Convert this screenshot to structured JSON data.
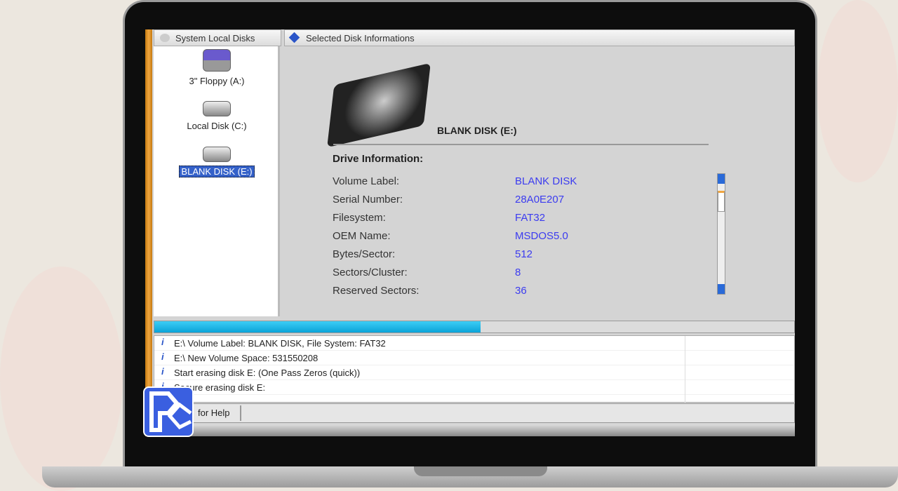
{
  "left_panel": {
    "title": "System Local Disks",
    "drives": [
      {
        "label": "3\" Floppy (A:)",
        "icon": "floppy-drive-icon"
      },
      {
        "label": "Local Disk (C:)",
        "icon": "hard-drive-icon"
      },
      {
        "label": "BLANK DISK (E:)",
        "icon": "hard-drive-icon",
        "selected": true
      }
    ]
  },
  "right_panel": {
    "title": "Selected Disk Informations",
    "disk_name": "BLANK DISK  (E:)",
    "section": "Drive Information:",
    "fields": [
      {
        "label": "Volume Label:",
        "value": "BLANK DISK"
      },
      {
        "label": "Serial Number:",
        "value": "28A0E207"
      },
      {
        "label": "Filesystem:",
        "value": "FAT32"
      },
      {
        "label": "OEM Name:",
        "value": "MSDOS5.0"
      },
      {
        "label": "Bytes/Sector:",
        "value": "512"
      },
      {
        "label": "Sectors/Cluster:",
        "value": "8"
      },
      {
        "label": "Reserved Sectors:",
        "value": "36"
      }
    ]
  },
  "progress_percent": 51,
  "log": [
    "E:\\ Volume Label: BLANK DISK, File System: FAT32",
    "E:\\ New Volume Space: 531550208",
    "Start erasing disk E: (One Pass Zeros (quick))",
    "Secure erasing disk E:"
  ],
  "status": {
    "help": "for Help"
  },
  "colors": {
    "accent": "#0aa3d8",
    "value_text": "#3b3bf0",
    "selection": "#3461c9",
    "logo": "#3a5fe0"
  }
}
